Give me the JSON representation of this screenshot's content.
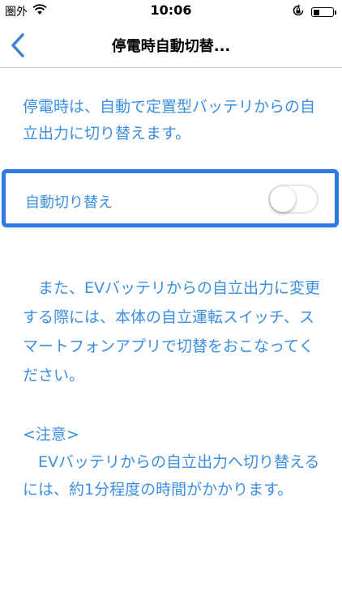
{
  "status_bar": {
    "carrier": "圏外",
    "time": "10:06",
    "battery_level": 0.35
  },
  "nav": {
    "title": "停電時自動切替..."
  },
  "intro": {
    "text": "停電時は、自動で定置型バッテリからの自立出力に切り替えます。"
  },
  "toggle": {
    "label": "自動切り替え",
    "state": "off"
  },
  "note": {
    "text": "また、EVバッテリからの自立出力に変更する際には、本体の自立運転スイッチ、スマートフォンアプリで切替をおこなってください。"
  },
  "caution": {
    "heading": "<注意>",
    "text": "EVバッテリからの自立出力へ切り替えるには、約1分程度の時間がかかります。"
  },
  "colors": {
    "accent": "#3c8fe0",
    "highlight_border": "#2b7be3",
    "back_arrow": "#3b82d6"
  }
}
